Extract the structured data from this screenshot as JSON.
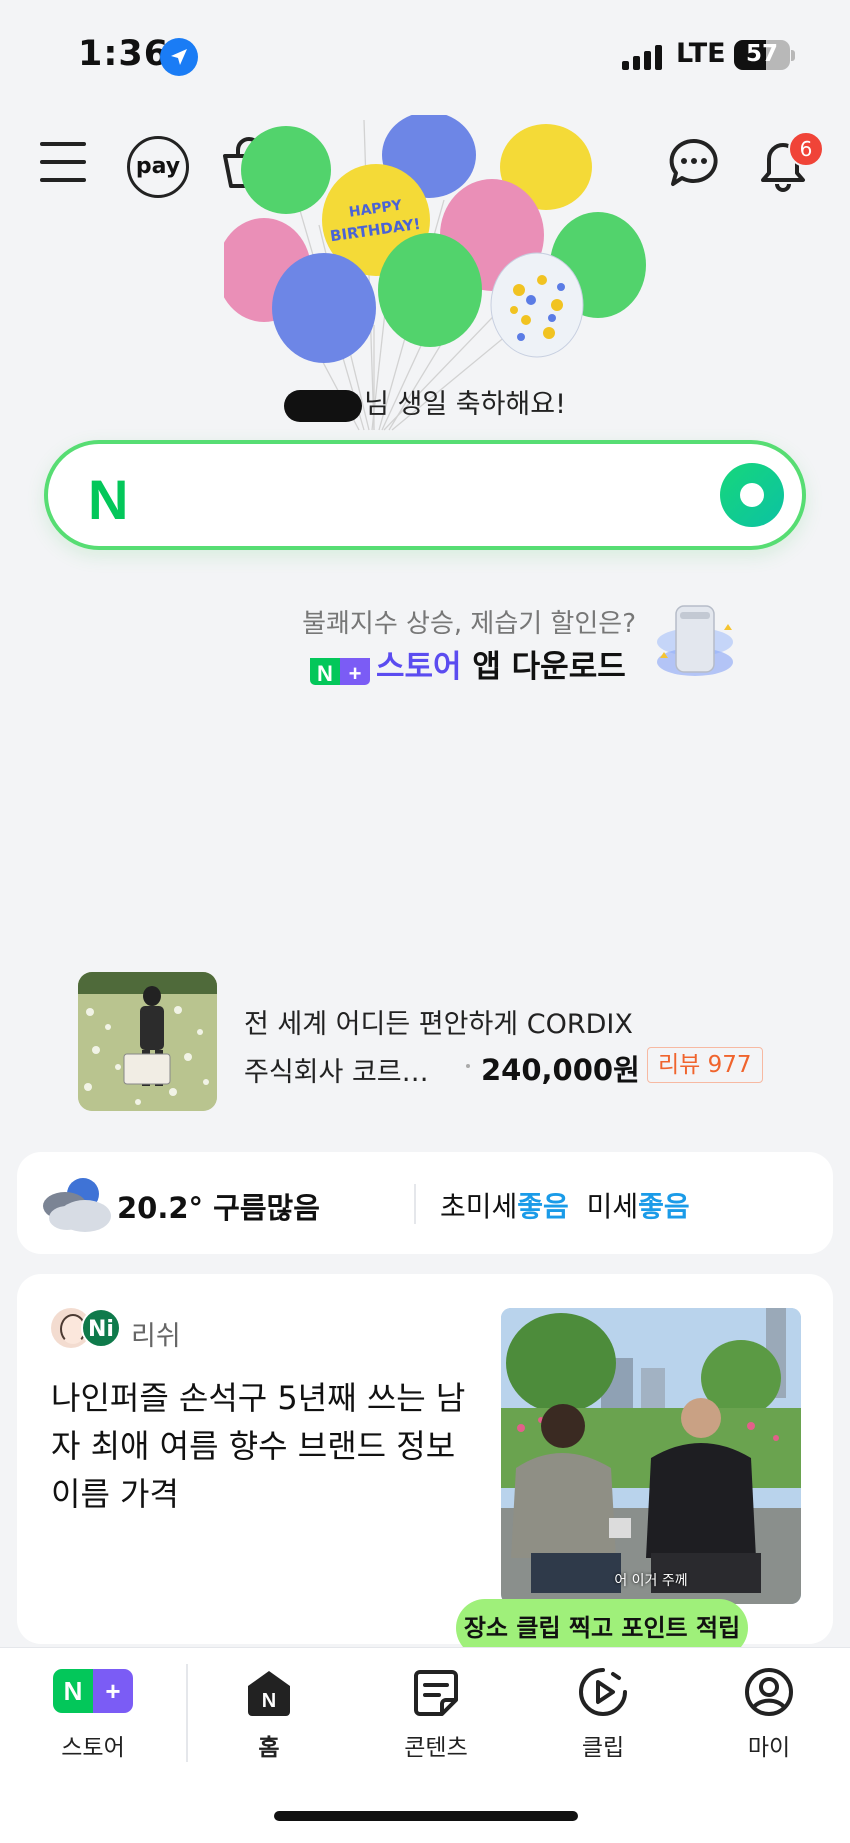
{
  "status_bar": {
    "time": "1:36",
    "network": "LTE",
    "battery": "57"
  },
  "header": {
    "icons": [
      "menu-icon",
      "pay-icon",
      "shopping-bag-icon",
      "chat-icon",
      "bell-icon"
    ],
    "pay_label": "pay",
    "notification_count": "6",
    "balloon_text": "HAPPY BIRTHDAY!"
  },
  "birthday": {
    "message": "님 생일 축하해요!"
  },
  "search": {
    "logo": "N",
    "placeholder": "",
    "accent_color": "#57dd73"
  },
  "promo": {
    "subtitle": "불쾌지수 상승, 제습기 할인은?",
    "badge_n": "N",
    "badge_plus": "+",
    "store": "스토어",
    "action": " 앱 다운로드"
  },
  "ad": {
    "title": "전 세계 어디든 편안하게 CORDIX",
    "company": "주식회사 코르…",
    "price": "240,000원",
    "review": "리뷰 977"
  },
  "weather": {
    "temperature": "20.2°",
    "condition": "구름많음",
    "ultrafine_label": "초미세",
    "ultrafine_value": "좋음",
    "fine_label": "미세",
    "fine_value": "좋음"
  },
  "content_card": {
    "author_badge": "Ni",
    "author": "리쉬",
    "title": "나인퍼즐 손석구 5년째 쓰는 남자 최애 여름 향수 브랜드 정보 이름 가격",
    "thumb_caption": "어 이거 주께"
  },
  "tooltip": {
    "text": "장소 클립 찍고 포인트 적립"
  },
  "tab_bar": {
    "store_n": "N",
    "store_plus": "+",
    "home_icon_letter": "N",
    "tabs": [
      {
        "label": "스토어",
        "icon": "naver-plus-store-icon"
      },
      {
        "label": "홈",
        "icon": "home-icon",
        "active": true
      },
      {
        "label": "콘텐츠",
        "icon": "contents-icon"
      },
      {
        "label": "클립",
        "icon": "clip-play-icon"
      },
      {
        "label": "마이",
        "icon": "profile-icon"
      }
    ]
  }
}
